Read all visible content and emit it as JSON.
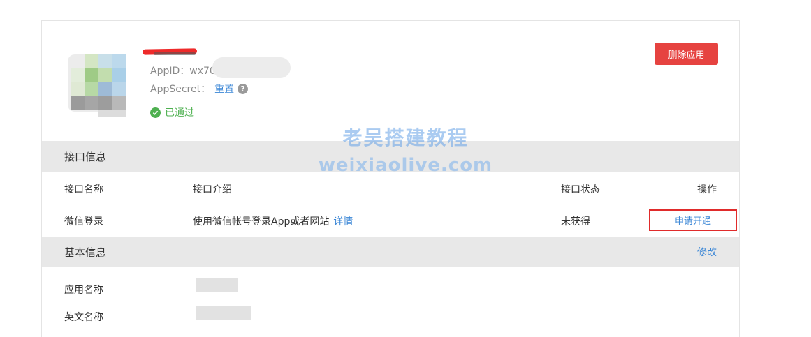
{
  "app": {
    "appid_label": "AppID：wx70",
    "appsecret_label": "AppSecret：",
    "reset_link": "重置",
    "help_glyph": "?",
    "status_text": "已通过",
    "delete_button": "删除应用"
  },
  "api_section": {
    "title": "接口信息",
    "columns": [
      "接口名称",
      "接口介绍",
      "接口状态",
      "操作"
    ],
    "row": {
      "name": "微信登录",
      "description": "使用微信帐号登录App或者网站",
      "detail_link": "详情",
      "status": "未获得",
      "action": "申请开通"
    }
  },
  "basic_section": {
    "title": "基本信息",
    "edit_link": "修改",
    "fields": [
      "应用名称",
      "英文名称"
    ]
  },
  "watermark": {
    "line1": "老吴搭建教程",
    "line2": "weixiaolive.com"
  },
  "colors": {
    "danger": "#e64340",
    "link": "#3a86d6",
    "success": "#4eb050",
    "section_bg": "#e8e8e8"
  }
}
